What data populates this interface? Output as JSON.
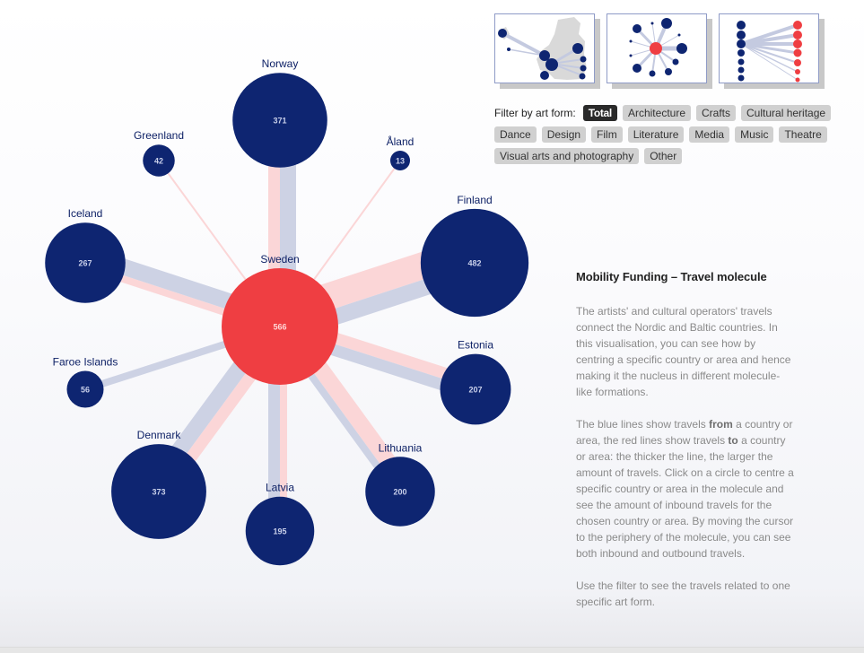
{
  "thumbnails": [
    {
      "name": "map-view",
      "label": "Map view"
    },
    {
      "name": "molecule-view",
      "label": "Molecule view"
    },
    {
      "name": "comparison-view",
      "label": "Comparison view"
    }
  ],
  "filter": {
    "label": "Filter by art form:",
    "options": [
      "Total",
      "Architecture",
      "Crafts",
      "Cultural heritage",
      "Dance",
      "Design",
      "Film",
      "Literature",
      "Media",
      "Music",
      "Theatre",
      "Visual arts and photography",
      "Other"
    ],
    "active": "Total"
  },
  "info": {
    "title": "Mobility Funding – Travel molecule",
    "paragraph1": "The artists' and cultural operators' travels connect the Nordic and Baltic countries. In this visualisation, you can see how by centring a specific country or area and hence making it the nucleus in different molecule-like formations.",
    "paragraph2_parts": [
      "The blue lines show travels ",
      "from",
      " a country or area, the red lines show travels ",
      "to",
      " a country or area: the thicker the line, the larger the amount of travels. Click on a circle to centre a specific country or area in the molecule and see the amount of inbound travels for the chosen country or area. By moving the cursor to the periphery of the molecule, you can see both inbound and outbound travels."
    ],
    "paragraph3": "Use the filter to see the travels related to one specific art form."
  },
  "colors": {
    "node": "#0e2571",
    "center": "#ef3e42",
    "outbound_link": "#cdd2e4",
    "inbound_link": "#fbd6d7"
  },
  "chart_data": {
    "type": "network",
    "title": "Mobility Funding – Travel molecule",
    "center": {
      "name": "Sweden",
      "value": 566
    },
    "nodes": [
      {
        "name": "Norway",
        "value": 371,
        "outbound_weight": "high",
        "inbound_weight": "medium"
      },
      {
        "name": "Greenland",
        "value": 42,
        "outbound_weight": "none",
        "inbound_weight": "very-low"
      },
      {
        "name": "Åland",
        "value": 13,
        "outbound_weight": "none",
        "inbound_weight": "very-low"
      },
      {
        "name": "Iceland",
        "value": 267,
        "outbound_weight": "high",
        "inbound_weight": "low"
      },
      {
        "name": "Finland",
        "value": 482,
        "outbound_weight": "high",
        "inbound_weight": "very-high"
      },
      {
        "name": "Faroe Islands",
        "value": 56,
        "outbound_weight": "low",
        "inbound_weight": "none"
      },
      {
        "name": "Estonia",
        "value": 207,
        "outbound_weight": "medium",
        "inbound_weight": "medium"
      },
      {
        "name": "Denmark",
        "value": 373,
        "outbound_weight": "high",
        "inbound_weight": "medium"
      },
      {
        "name": "Latvia",
        "value": 195,
        "outbound_weight": "medium",
        "inbound_weight": "low"
      },
      {
        "name": "Lithuania",
        "value": 200,
        "outbound_weight": "low",
        "inbound_weight": "high"
      }
    ],
    "legend": {
      "blue": "travels from a country or area",
      "red": "travels to a country or area"
    }
  }
}
